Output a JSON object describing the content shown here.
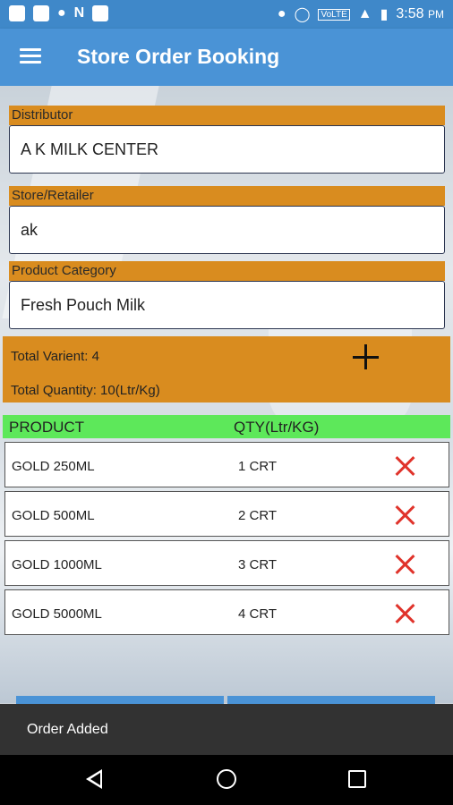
{
  "status_bar": {
    "left_icons": [
      "notification-icon",
      "n-icon",
      "car-icon",
      "n-icon",
      "app-icon"
    ],
    "right_icons": [
      "location-icon",
      "alarm-icon",
      "volte-icon",
      "signal-icon",
      "battery-icon"
    ],
    "volte": "VoLTE",
    "time": "3:58",
    "ampm": "PM"
  },
  "app_bar": {
    "title": "Store Order Booking"
  },
  "form": {
    "distributor_label": "Distributor",
    "distributor_value": "A K MILK CENTER",
    "store_label": "Store/Retailer",
    "store_value": "ak",
    "category_label": "Product Category",
    "category_value": "Fresh Pouch Milk"
  },
  "summary": {
    "total_variant": "Total Varient: 4",
    "total_quantity": "Total Quantity: 10(Ltr/Kg)"
  },
  "table": {
    "headers": {
      "product": "PRODUCT",
      "qty": "QTY(Ltr/KG)"
    },
    "rows": [
      {
        "product": "GOLD 250ML",
        "qty": "1 CRT"
      },
      {
        "product": "GOLD 500ML",
        "qty": "2 CRT"
      },
      {
        "product": "GOLD 1000ML",
        "qty": "3 CRT"
      },
      {
        "product": "GOLD 5000ML",
        "qty": "4 CRT"
      }
    ]
  },
  "snackbar": {
    "message": "Order Added"
  },
  "colors": {
    "app_bar": "#4a93d6",
    "label_orange": "#d98c1f",
    "table_header_green": "#5de85a",
    "delete_red": "#e0332b"
  }
}
